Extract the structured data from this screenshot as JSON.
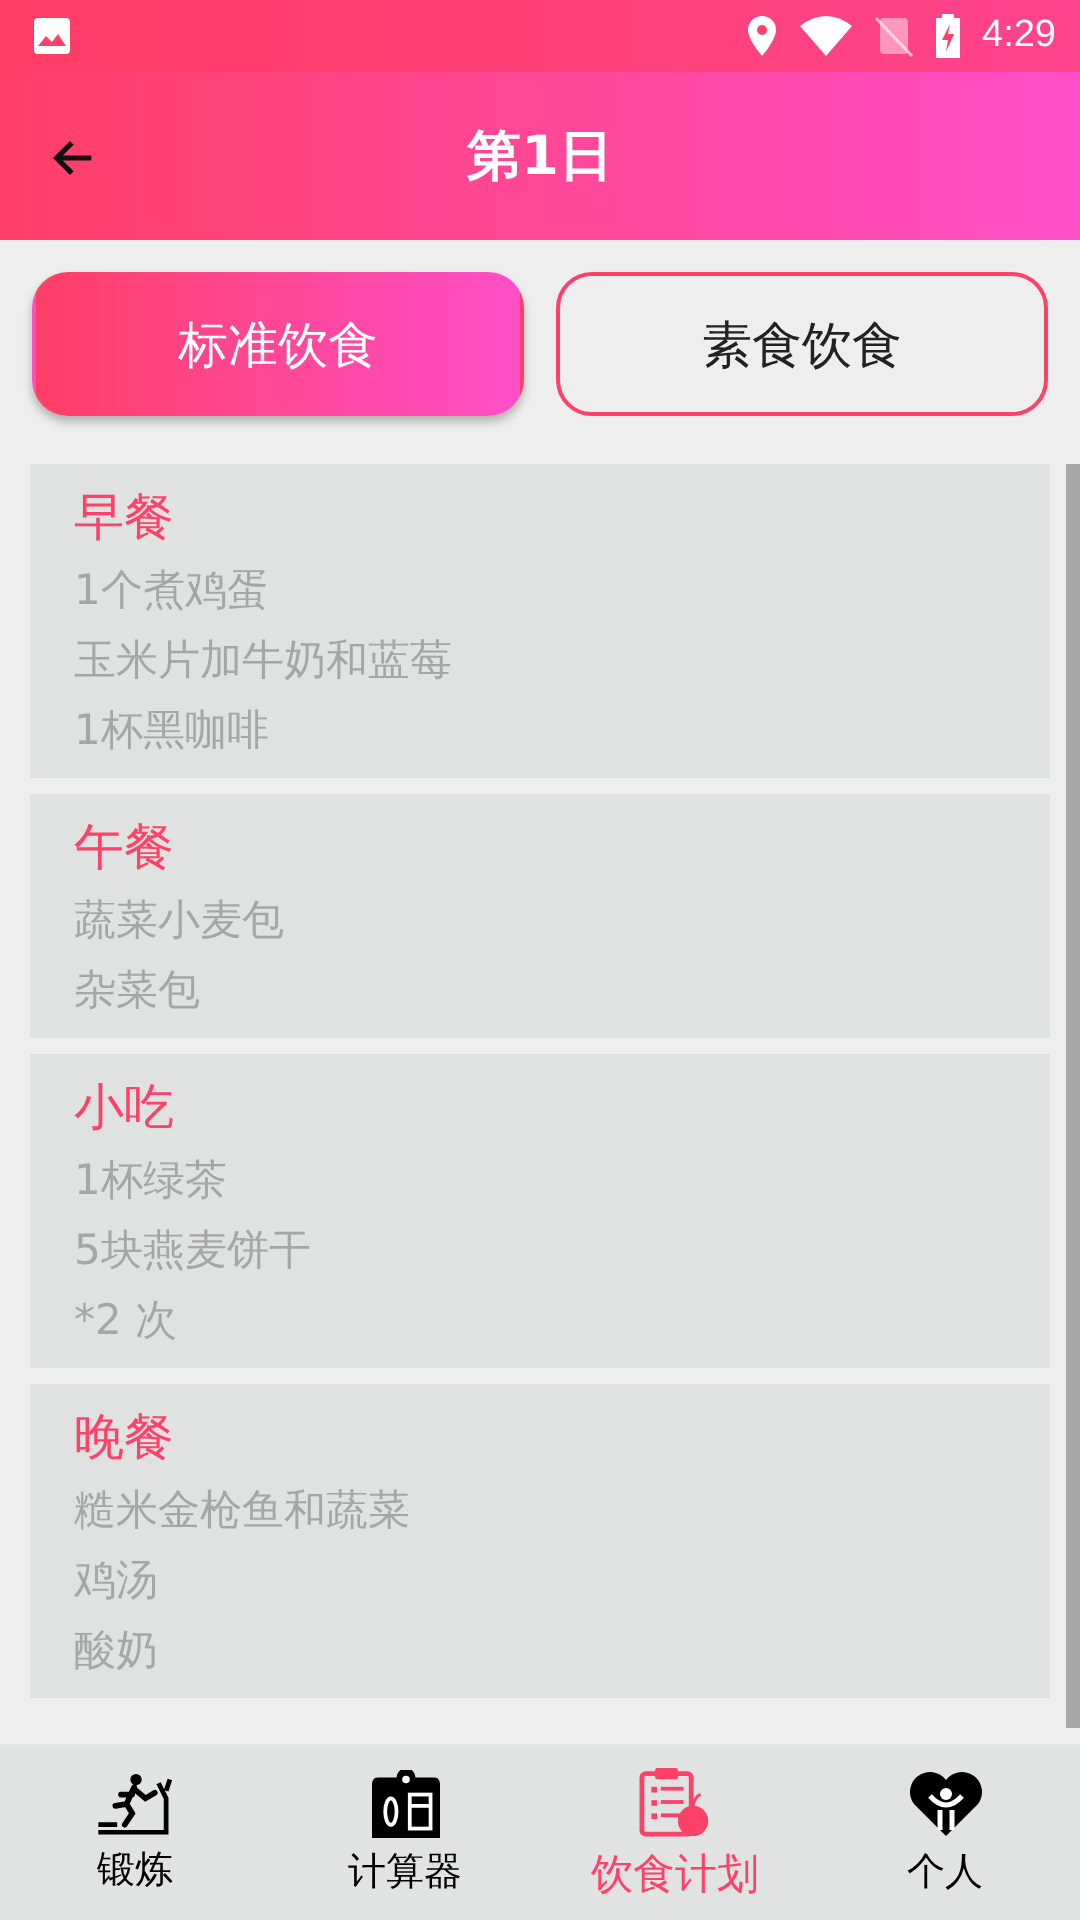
{
  "status_bar": {
    "time": "4:29"
  },
  "app_bar": {
    "title": "第1日"
  },
  "tabs": [
    {
      "label": "标准饮食",
      "selected": true
    },
    {
      "label": "素食饮食",
      "selected": false
    }
  ],
  "meals": [
    {
      "title": "早餐",
      "items": [
        "1个煮鸡蛋",
        "玉米片加牛奶和蓝莓",
        "1杯黑咖啡"
      ]
    },
    {
      "title": "午餐",
      "items": [
        "蔬菜小麦包",
        "杂菜包"
      ]
    },
    {
      "title": "小吃",
      "items": [
        "1杯绿茶",
        "5块燕麦饼干",
        "*2 次"
      ]
    },
    {
      "title": "晚餐",
      "items": [
        "糙米金枪鱼和蔬菜",
        "鸡汤",
        "酸奶"
      ]
    }
  ],
  "bottom_nav": [
    {
      "label": "锻炼",
      "kind": "exercise",
      "selected": false
    },
    {
      "label": "计算器",
      "kind": "calculator",
      "selected": false
    },
    {
      "label": "饮食计划",
      "kind": "diet",
      "selected": true
    },
    {
      "label": "个人",
      "kind": "profile",
      "selected": false
    }
  ]
}
